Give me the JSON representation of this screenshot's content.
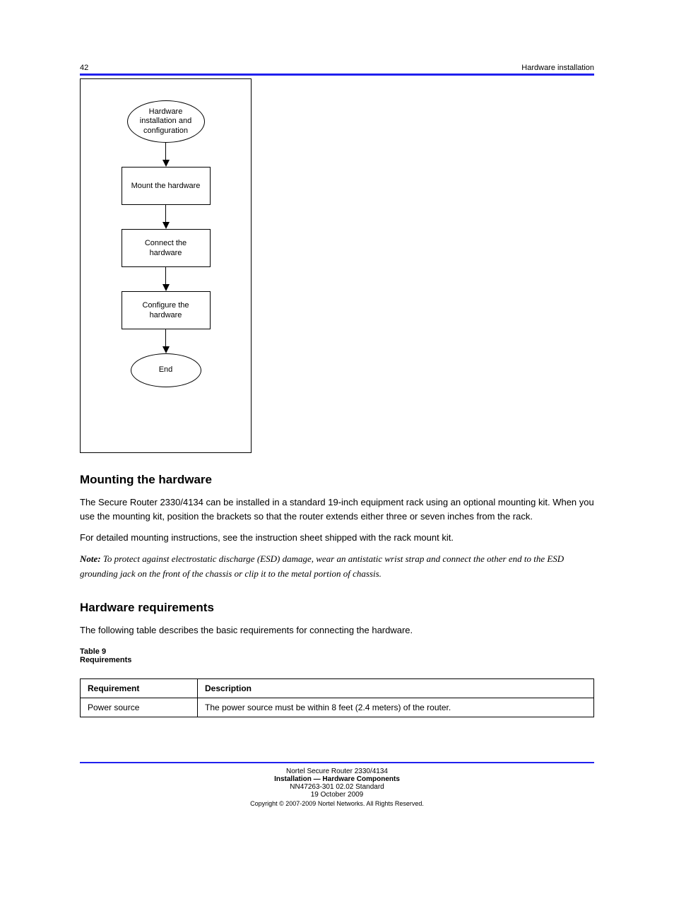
{
  "header": {
    "page": "42",
    "title": "Hardware installation"
  },
  "flowchart": {
    "start": "Hardware installation and configuration",
    "step1": "Mount the hardware",
    "step2": "Connect the hardware",
    "step3": "Configure the hardware",
    "end": "End"
  },
  "section_mounting": {
    "title": "Mounting the hardware",
    "para1": "The Secure Router 2330/4134 can be installed in a standard 19-inch equipment rack using an optional mounting kit. When you use the mounting kit, position the brackets so that the router extends either three or seven inches from the rack.",
    "para2": "For detailed mounting instructions, see the instruction sheet shipped with the rack mount kit.",
    "note_label": "Note:",
    "note_text": " To protect against electrostatic discharge (ESD) damage, wear an antistatic wrist strap and connect the other end to the ESD grounding jack on the front of the chassis or clip it to the metal portion of chassis."
  },
  "section_requirements": {
    "title": "Hardware requirements",
    "intro": "The following table describes the basic requirements for connecting the hardware.",
    "table": {
      "caption": "Table 9",
      "subcaption": "Requirements",
      "headers": [
        "Requirement",
        "Description"
      ],
      "rows": [
        {
          "req": "Power source",
          "desc": "The power source must be within 8 feet (2.4 meters) of the router."
        }
      ]
    }
  },
  "footer": {
    "left": "Nortel Secure Router 2330/4134",
    "center_line1": "Installation — Hardware Components",
    "center_line2": "NN47263-301   02.02   Standard",
    "center_line3": "19 October 2009",
    "copyright": "Copyright © 2007-2009 Nortel Networks. All Rights Reserved."
  }
}
